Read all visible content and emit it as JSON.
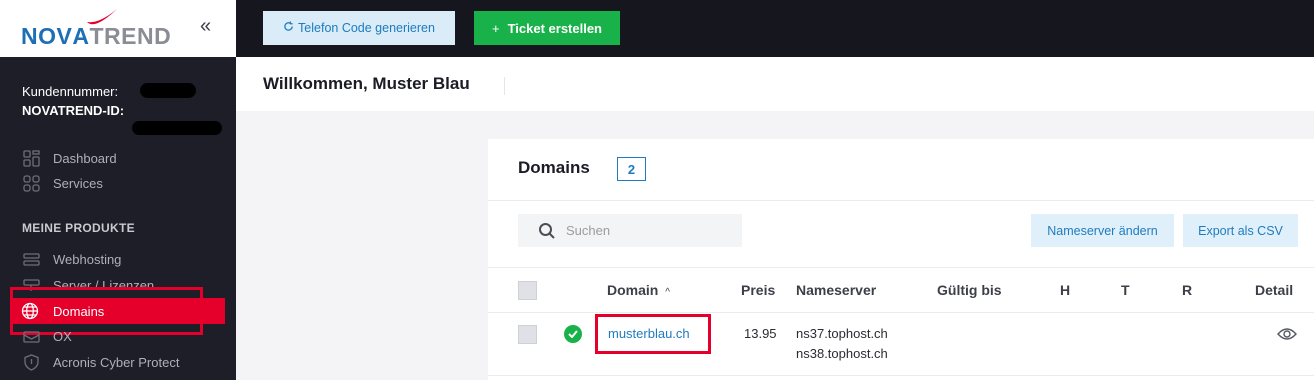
{
  "brand": {
    "logo_part1": "NO",
    "logo_part2": "V",
    "logo_part3": "A",
    "logo_part4": "TREND"
  },
  "sidebar": {
    "customer_number_label": "Kundennummer:",
    "novatrend_id_label": "NOVATREND-ID:",
    "nav_top": [
      {
        "label": "Dashboard",
        "icon": "dashboard-icon"
      },
      {
        "label": "Services",
        "icon": "services-icon"
      }
    ],
    "section_title": "MEINE PRODUKTE",
    "products": [
      {
        "label": "Webhosting",
        "icon": "webhosting-icon"
      },
      {
        "label": "Server / Lizenzen",
        "icon": "server-icon"
      },
      {
        "label": "Domains",
        "icon": "globe-icon",
        "active": true
      },
      {
        "label": "OX",
        "icon": "ox-icon"
      },
      {
        "label": "Acronis Cyber Protect",
        "icon": "shield-icon"
      }
    ]
  },
  "topbar": {
    "phone_code_button": "Telefon Code generieren",
    "ticket_button": "Ticket erstellen"
  },
  "welcome": {
    "title": "Willkommen, Muster Blau"
  },
  "domains": {
    "title": "Domains",
    "count": "2",
    "search_placeholder": "Suchen",
    "nameserver_button": "Nameserver ändern",
    "export_button": "Export als CSV",
    "columns": {
      "domain": "Domain",
      "price": "Preis",
      "nameserver": "Nameserver",
      "valid_until": "Gültig bis",
      "h": "H",
      "t": "T",
      "r": "R",
      "detail": "Detail"
    },
    "rows": [
      {
        "domain": "musterblau.ch",
        "price": "13.95",
        "nameserver1": "ns37.tophost.ch",
        "nameserver2": "ns38.tophost.ch",
        "valid_until": "",
        "status": "active"
      }
    ]
  },
  "colors": {
    "accent": "#1f7bbf",
    "brand_red": "#e4002b",
    "success": "#19b24a",
    "sidebar_bg": "#1d1e27"
  }
}
